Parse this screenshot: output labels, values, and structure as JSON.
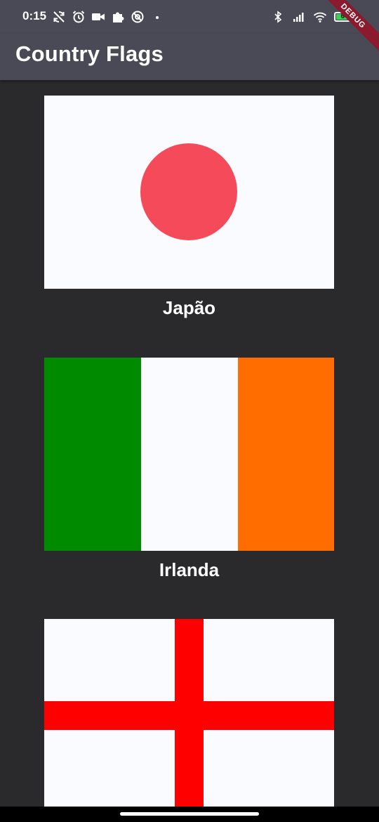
{
  "status_bar": {
    "time": "0:15",
    "battery_level": "64",
    "icons_left": [
      "no-sync-icon",
      "alarm-icon",
      "video-icon",
      "puzzle-icon",
      "at-icon",
      "dot-icon"
    ],
    "icons_right": [
      "bluetooth-icon",
      "signal-icon",
      "wifi-icon",
      "battery-icon"
    ]
  },
  "debug_banner": "DEBUG",
  "app_bar": {
    "title": "Country Flags"
  },
  "colors": {
    "app_bar": "#4a4a57",
    "background": "#2a2a2c",
    "flag_white": "#fafbff",
    "japan_red": "#f54a5a",
    "ireland_green": "#008a00",
    "ireland_orange": "#ff6d00",
    "england_red": "#ff0000"
  },
  "flags": [
    {
      "name": "Japão",
      "icon": "japan-flag",
      "colors": [
        "#fafbff",
        "#f54a5a"
      ]
    },
    {
      "name": "Irlanda",
      "icon": "ireland-flag",
      "colors": [
        "#008a00",
        "#fafbff",
        "#ff6d00"
      ]
    },
    {
      "name": "",
      "icon": "england-flag",
      "colors": [
        "#fafbff",
        "#ff0000"
      ]
    }
  ]
}
